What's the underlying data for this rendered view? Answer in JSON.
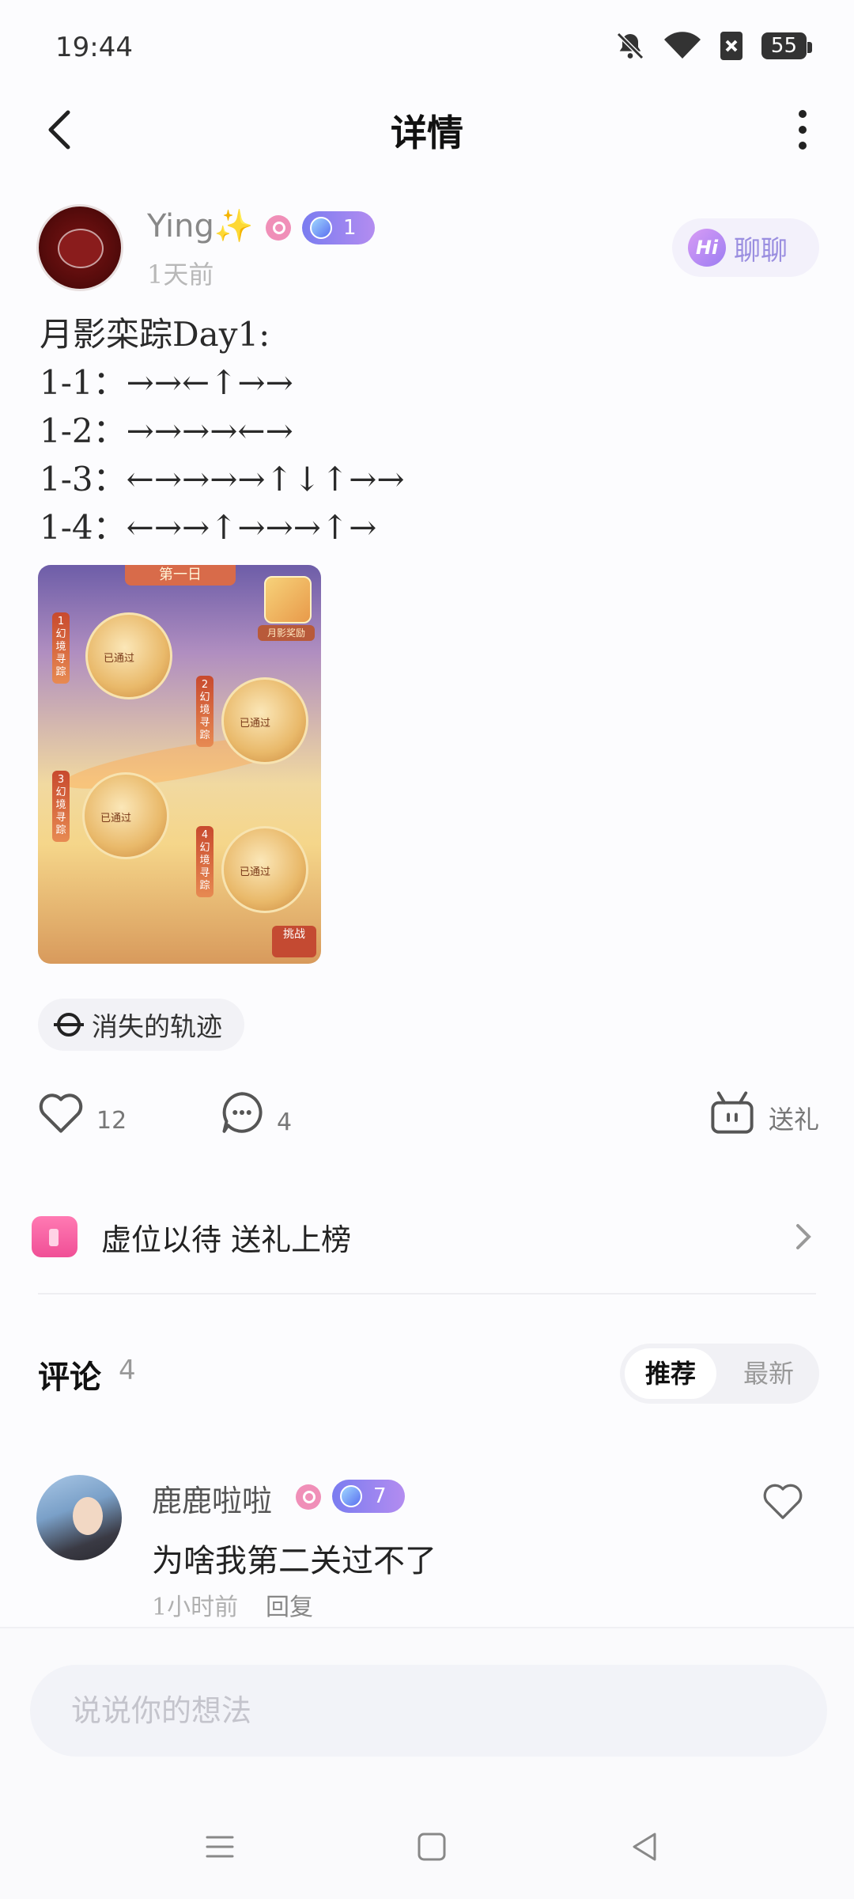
{
  "status_bar": {
    "time": "19:44",
    "battery": "55",
    "icons": [
      "bell-off-icon",
      "wifi-icon",
      "sim-off-icon",
      "battery-icon"
    ]
  },
  "header": {
    "title": "详情",
    "back_icon": "chevron-left-icon",
    "more_icon": "more-vertical-icon"
  },
  "author": {
    "name": "Ying✨",
    "level": "1",
    "time": "1天前",
    "chat_label": "聊聊",
    "chat_icon_text": "Hi"
  },
  "post": {
    "lines": [
      "月影栾踪Day1:",
      "1-1：→→←↑→→",
      "1-2：→→→→←→",
      "1-3：←→→→→↑↓↑→→",
      "1-4：←→→↑→→→↑→"
    ],
    "image_text": {
      "banner": "第一日",
      "gift_label": "月影奖励",
      "passed": "已通过",
      "node_tags": [
        "1 幻境寻踪",
        "2 幻境寻踪",
        "3 幻境寻踪",
        "4 幻境寻踪"
      ],
      "challenge": "挑战"
    }
  },
  "topic": {
    "label": "消失的轨迹",
    "icon": "topic-icon"
  },
  "actions": {
    "likes": "12",
    "comments": "4",
    "gift_label": "送礼"
  },
  "gift_rank": {
    "label": "虚位以待 送礼上榜"
  },
  "comments": {
    "title": "评论",
    "count": "4",
    "sort_options": [
      "推荐",
      "最新"
    ],
    "selected_sort": "推荐",
    "items": [
      {
        "name": "鹿鹿啦啦",
        "level": "7",
        "text": "为啥我第二关过不了",
        "time": "1小时前",
        "reply_label": "回复"
      }
    ]
  },
  "input": {
    "placeholder": "说说你的想法"
  },
  "colors": {
    "accent_purple": "#9a8ee0",
    "badge_gradient_start": "#7a7cf0",
    "gift_pink": "#f04f96"
  }
}
